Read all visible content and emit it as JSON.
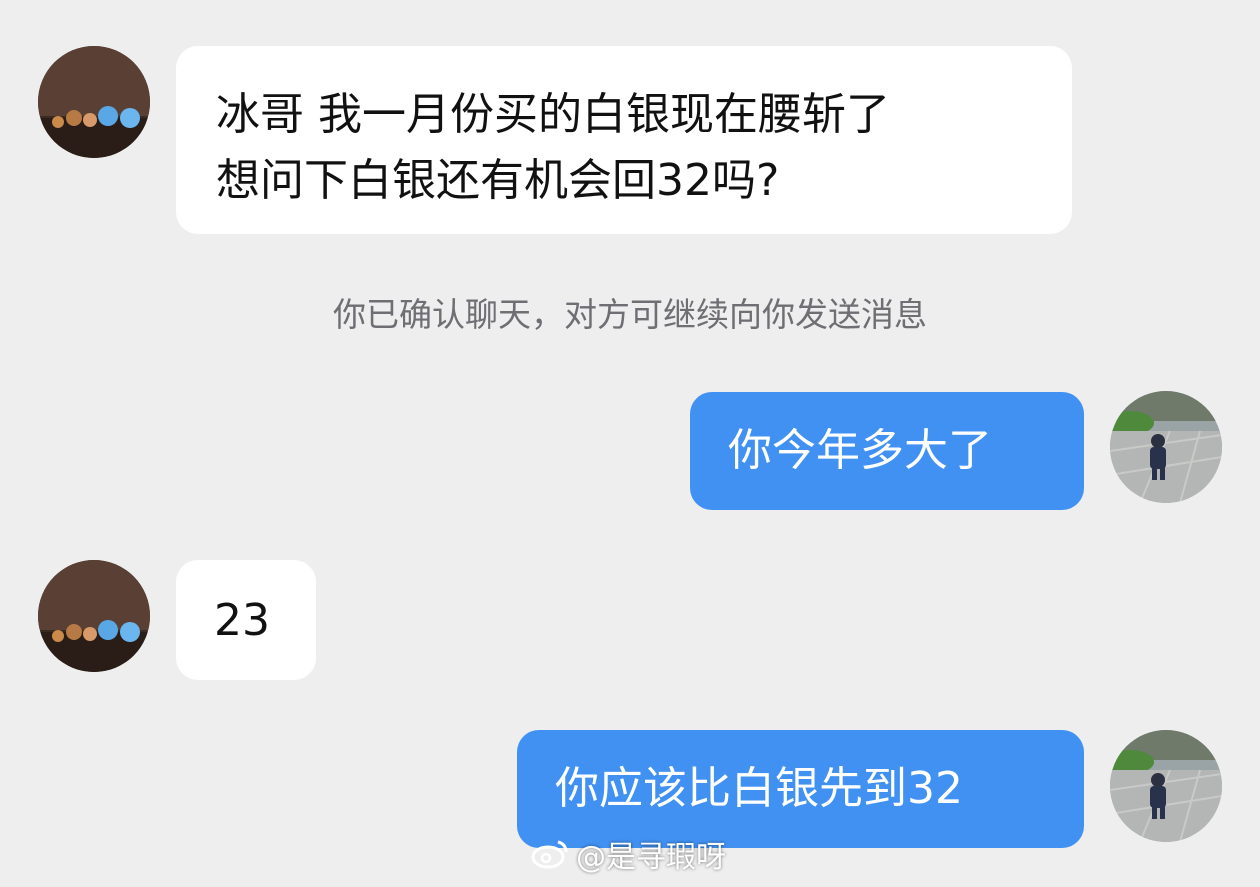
{
  "messages": [
    {
      "side": "in",
      "lines": [
        "冰哥 我一月份买的白银现在腰斩了",
        "想问下白银还有机会回32吗?"
      ]
    },
    {
      "side": "system",
      "text": "你已确认聊天，对方可继续向你发送消息"
    },
    {
      "side": "out",
      "text": "你今年多大了"
    },
    {
      "side": "in",
      "text": "23"
    },
    {
      "side": "out",
      "text": "你应该比白银先到32"
    }
  ],
  "watermark": {
    "text": "@是寻瑕呀",
    "icon": "weibo-icon"
  },
  "colors": {
    "background": "#eeeeef",
    "incoming_bubble": "#ffffff",
    "outgoing_bubble": "#4191f2",
    "system_text": "#6e6e73"
  }
}
